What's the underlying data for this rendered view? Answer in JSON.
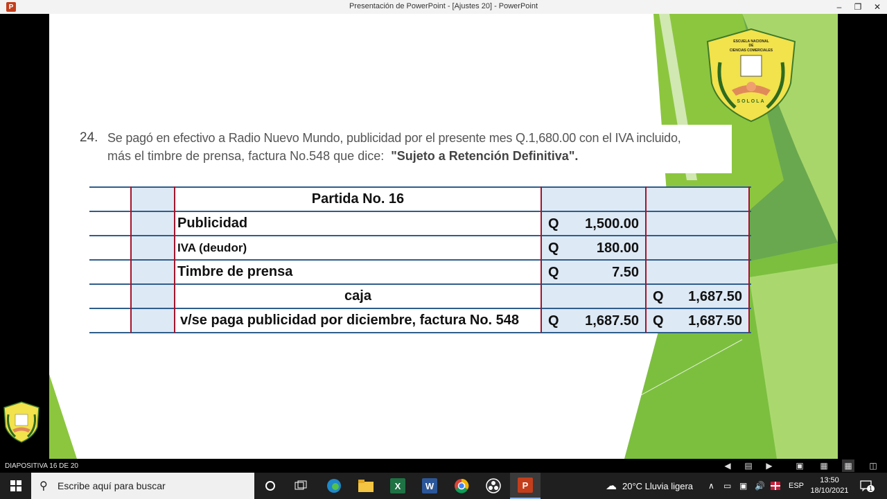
{
  "window": {
    "title": "Presentación de PowerPoint - [Ajustes 20] - PowerPoint",
    "app_icon": "P"
  },
  "slide": {
    "question_number": "24.",
    "question_line1": "Se pagó en efectivo a Radio Nuevo Mundo, publicidad por el presente mes Q.1,680.00 con el IVA incluido,",
    "question_line2_prefix": "más el timbre de prensa, factura No.548 que dice:",
    "question_line2_quote": "\"Sujeto a Retención Definitiva\".",
    "logo_text": {
      "line1": "ESCUELA NACIONAL",
      "line2": "DE",
      "line3": "CIENCIAS COMERCIALES",
      "bottom": "SOLOLA"
    },
    "journal": {
      "header": "Partida No. 16",
      "rows": [
        {
          "desc": "Publicidad",
          "debit_q": "Q",
          "debit": "1,500.00",
          "credit_q": "",
          "credit": ""
        },
        {
          "desc": "IVA (deudor)",
          "debit_q": "Q",
          "debit": "180.00",
          "credit_q": "",
          "credit": ""
        },
        {
          "desc": "Timbre de prensa",
          "debit_q": "Q",
          "debit": "7.50",
          "credit_q": "",
          "credit": ""
        },
        {
          "desc": "caja",
          "debit_q": "",
          "debit": "",
          "credit_q": "Q",
          "credit": "1,687.50"
        },
        {
          "desc": "v/se paga publicidad por diciembre, factura No. 548",
          "debit_q": "Q",
          "debit": "1,687.50",
          "credit_q": "Q",
          "credit": "1,687.50"
        }
      ]
    }
  },
  "statusbar": {
    "slide_counter": "DIAPOSITIVA 16 DE 20"
  },
  "taskbar": {
    "search_placeholder": "Escribe aquí para buscar",
    "weather": "20°C  Lluvia ligera",
    "language": "ESP",
    "time": "13:50",
    "date": "18/10/2021",
    "notification_count": "1"
  },
  "colors": {
    "accent_green": "#8cc63f",
    "table_border_blue": "#2e5d8a",
    "table_border_red": "#a3142b",
    "cell_light_blue": "#dde9f5",
    "powerpoint_red": "#c43e1c"
  }
}
